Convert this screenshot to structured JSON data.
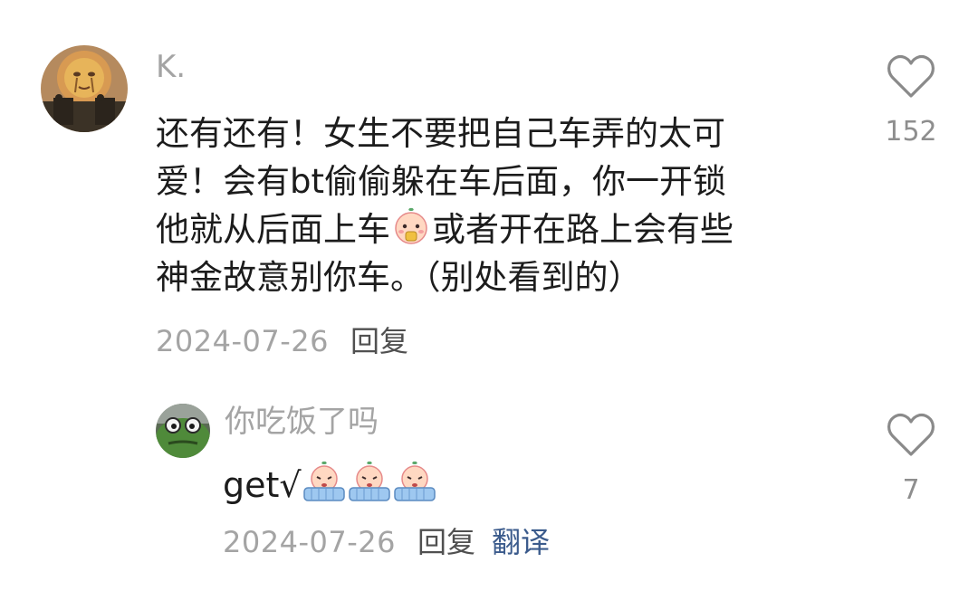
{
  "comment": {
    "username": "K.",
    "lines": [
      "还有还有！女生不要把自己车弄的太可",
      "爱！会有bt偷偷躲在车后面，你一开锁",
      "他就从后面上车",
      "或者开在路上会有些",
      "神金故意别你车。（别处看到的）"
    ],
    "date": "2024-07-26",
    "reply_label": "回复",
    "like_count": "152",
    "icons": {
      "avatar": "sun-face-avatar-icon",
      "emoji": "peach-face-emoji-icon",
      "like": "heart-outline-icon"
    }
  },
  "reply": {
    "username": "你吃饭了吗",
    "text": "get√",
    "date": "2024-07-26",
    "reply_label": "回复",
    "translate_label": "翻译",
    "like_count": "7",
    "icons": {
      "avatar": "green-cartoon-avatar-icon",
      "emoji": "crying-peach-emoji-icon",
      "like": "heart-outline-icon"
    }
  },
  "colors": {
    "text": "#1c1c1c",
    "muted": "#a4a4a4",
    "link": "#3b5b8c",
    "background": "#ffffff"
  }
}
